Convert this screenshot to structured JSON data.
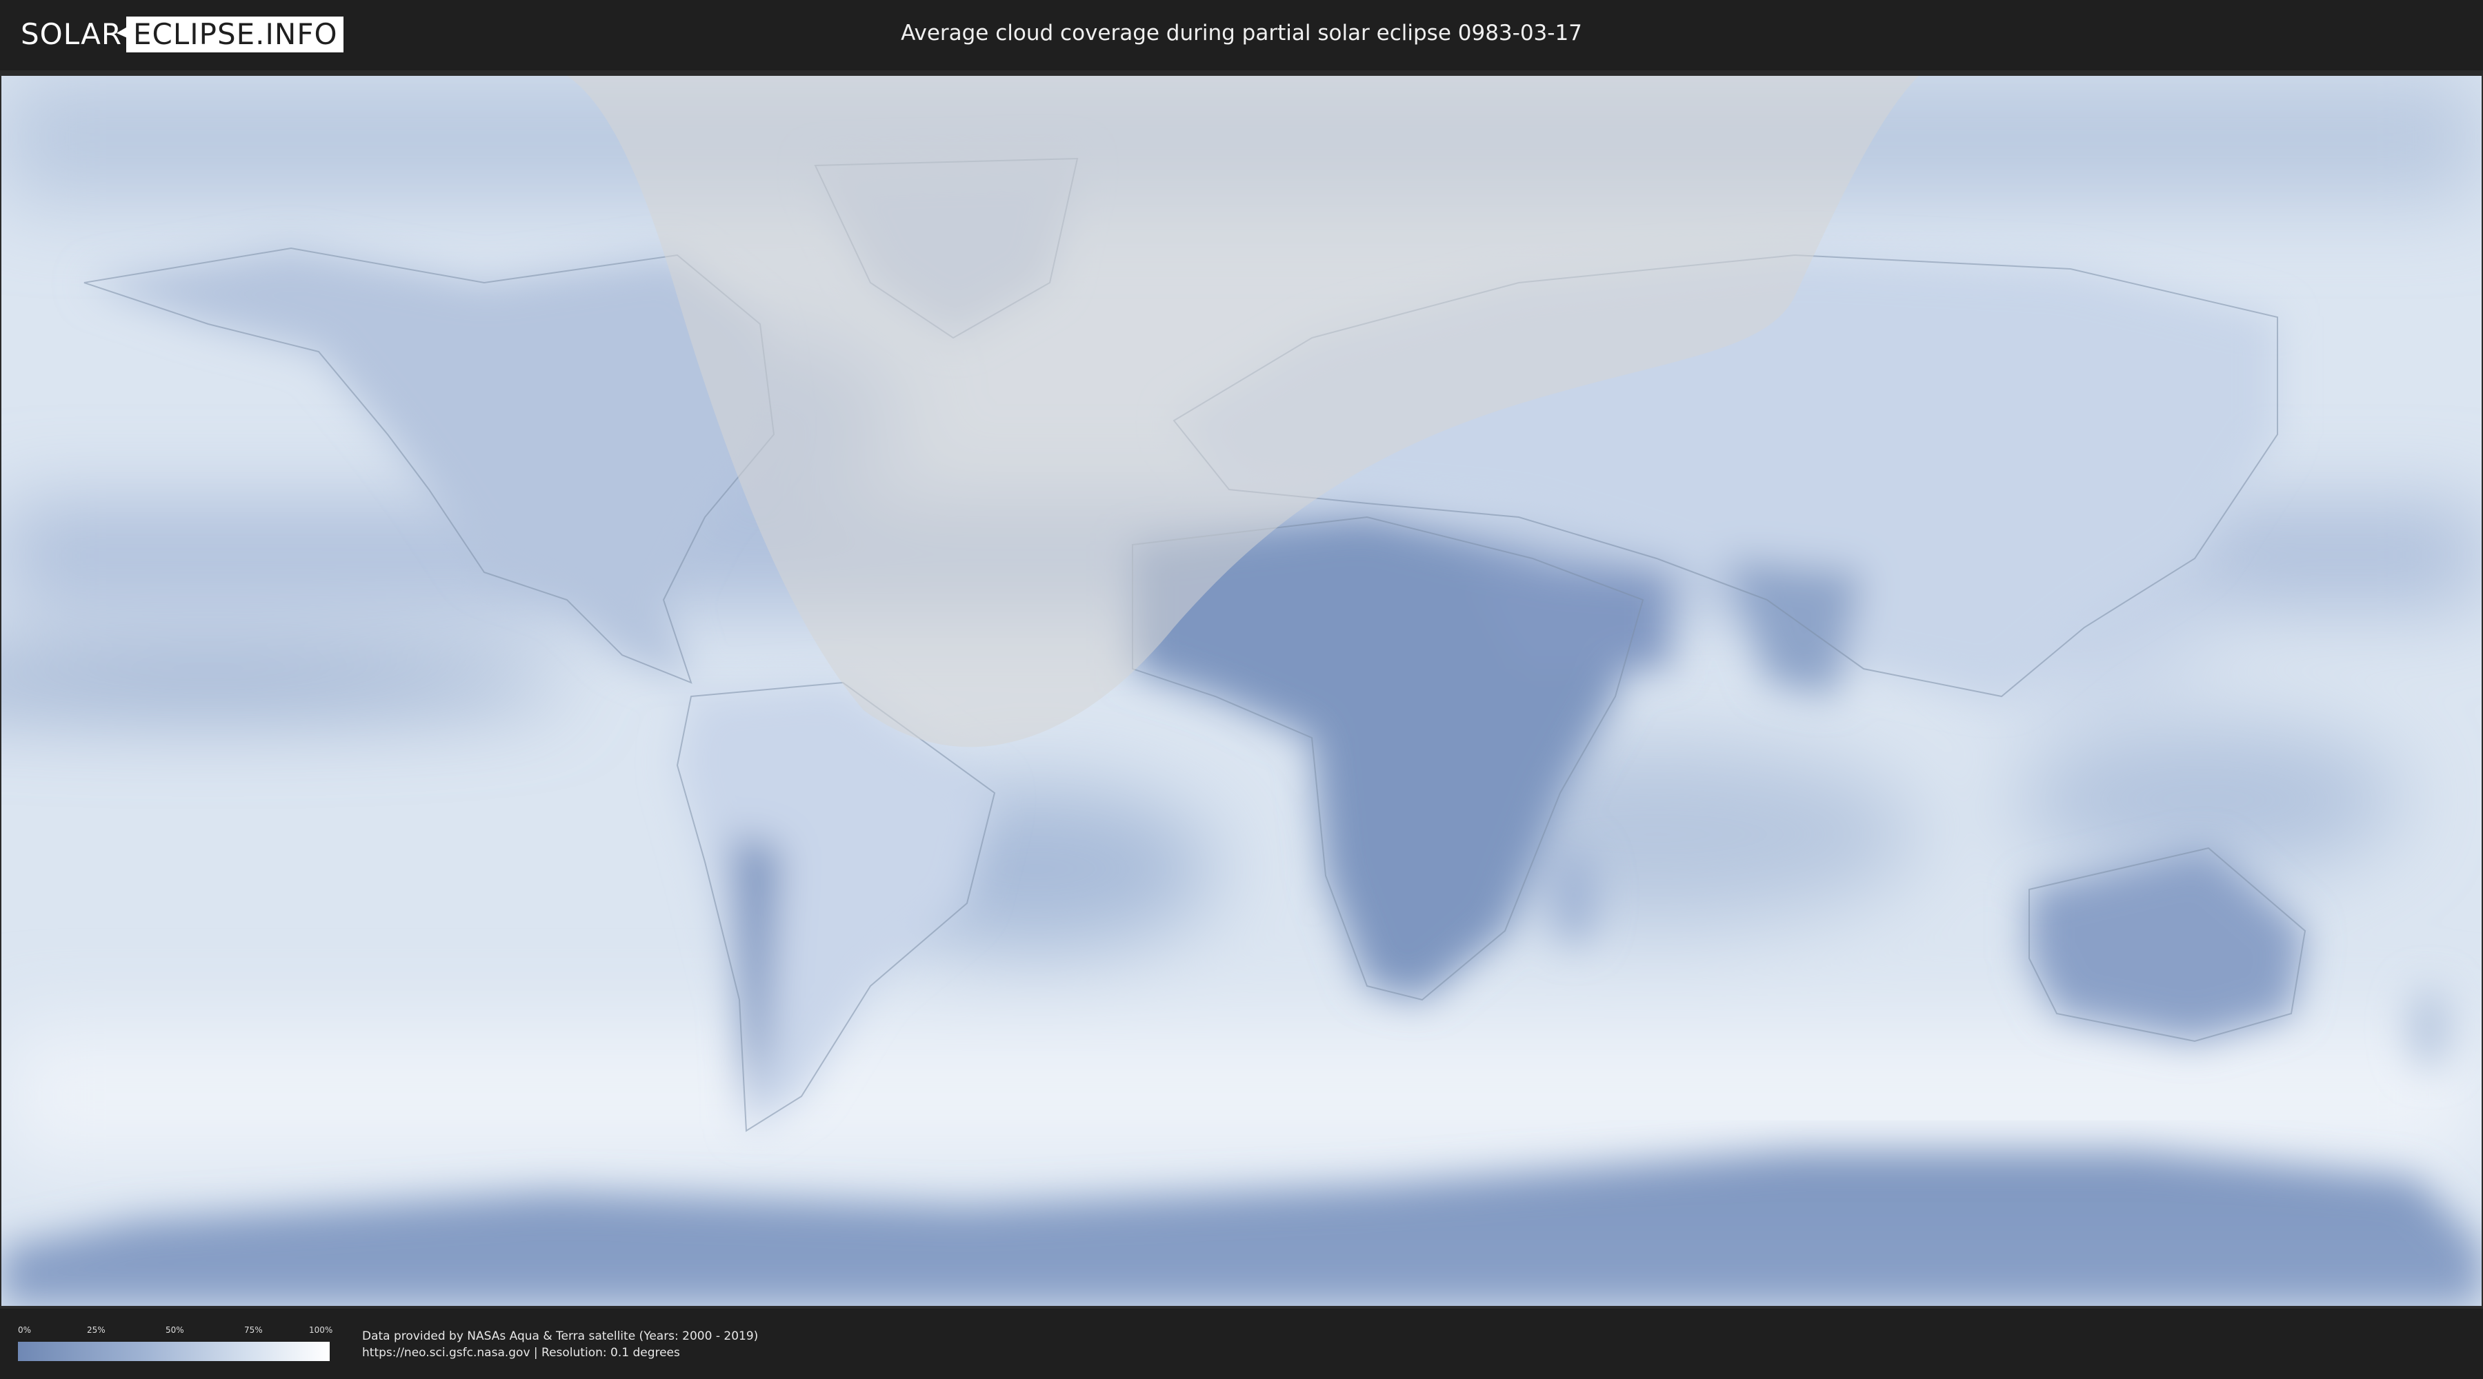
{
  "header": {
    "logo_left": "SOLAR",
    "logo_right": "ECLIPSE.INFO",
    "title": "Average cloud coverage during partial solar eclipse 0983-03-17"
  },
  "legend": {
    "ticks": [
      "0%",
      "25%",
      "50%",
      "75%",
      "100%"
    ],
    "low_color": "#6f88b4",
    "high_color": "#ffffff"
  },
  "credits": {
    "line1": "Data provided by NASAs Aqua & Terra satellite (Years: 2000 - 2019)",
    "line2": "https://neo.sci.gsfc.nasa.gov | Resolution: 0.1 degrees"
  },
  "map": {
    "projection": "equirectangular world map",
    "ocean_cloud_color": "#dce6f1",
    "clear_sky_color": "#6f88b4",
    "eclipse_zone_color": "#d8d8d8"
  }
}
